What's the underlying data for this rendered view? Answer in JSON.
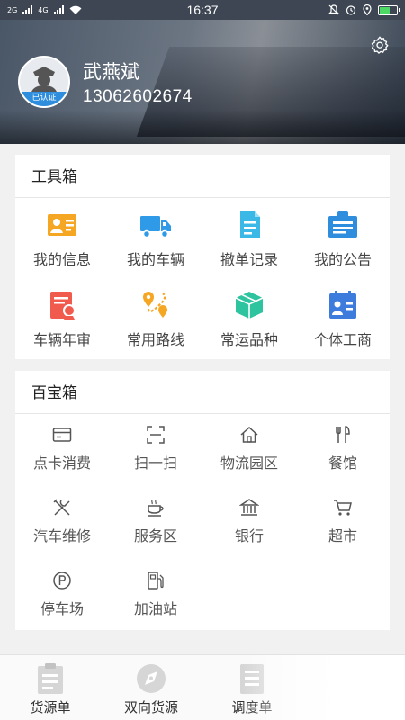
{
  "status_bar": {
    "network_left": "2G",
    "network_right": "4G",
    "time": "16:37",
    "icons": [
      "mute-icon",
      "alarm-icon",
      "location-icon",
      "battery-charging-icon"
    ],
    "battery_level": 0.6,
    "battery_color": "#4cd964"
  },
  "profile": {
    "name": "武燕斌",
    "phone": "13062602674",
    "verified_label": "已认证",
    "settings_icon": "gear-icon"
  },
  "toolbox": {
    "title": "工具箱",
    "items": [
      {
        "label": "我的信息",
        "icon": "id-card-icon",
        "color": "#f5a623"
      },
      {
        "label": "我的车辆",
        "icon": "truck-icon",
        "color": "#2e9ae8"
      },
      {
        "label": "撤单记录",
        "icon": "document-icon",
        "color": "#3cb8e6"
      },
      {
        "label": "我的公告",
        "icon": "notice-icon",
        "color": "#2e8ddc"
      },
      {
        "label": "车辆年审",
        "icon": "inspection-icon",
        "color": "#f05b4d"
      },
      {
        "label": "常用路线",
        "icon": "route-icon",
        "color": "#f5a623"
      },
      {
        "label": "常运品种",
        "icon": "box-icon",
        "color": "#2ec4a0"
      },
      {
        "label": "个体工商",
        "icon": "business-license-icon",
        "color": "#3d7bdc"
      }
    ]
  },
  "treasure_box": {
    "title": "百宝箱",
    "items": [
      {
        "label": "点卡消费",
        "icon": "card-icon"
      },
      {
        "label": "扫一扫",
        "icon": "scan-icon"
      },
      {
        "label": "物流园区",
        "icon": "home-icon"
      },
      {
        "label": "餐馆",
        "icon": "restaurant-icon"
      },
      {
        "label": "汽车维修",
        "icon": "repair-tools-icon"
      },
      {
        "label": "服务区",
        "icon": "coffee-icon"
      },
      {
        "label": "银行",
        "icon": "bank-icon"
      },
      {
        "label": "超市",
        "icon": "shopping-cart-icon"
      },
      {
        "label": "停车场",
        "icon": "parking-icon"
      },
      {
        "label": "加油站",
        "icon": "gas-station-icon"
      }
    ]
  },
  "tab_bar": {
    "tabs": [
      {
        "label": "货源单",
        "icon": "clipboard-icon"
      },
      {
        "label": "双向货源",
        "icon": "compass-icon"
      },
      {
        "label": "调度单",
        "icon": "list-document-icon"
      }
    ]
  },
  "colors": {
    "header_dark": "#3d4652",
    "verified_badge": "#2e8ddc",
    "icon_gray": "#555555"
  }
}
